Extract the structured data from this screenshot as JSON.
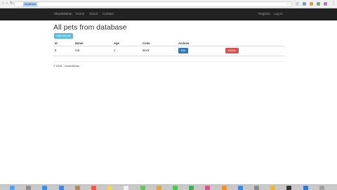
{
  "browser": {
    "url": "localhost"
  },
  "navbar": {
    "brand": "VroomDemo",
    "links": [
      "Home",
      "About",
      "Contact"
    ],
    "register": "Register",
    "login": "Log in"
  },
  "page": {
    "title": "All pets from database",
    "create_label": "Add new pet",
    "columns": [
      "Id",
      "Name",
      "Age",
      "Color",
      "Actions"
    ],
    "rows": [
      {
        "id": "8",
        "name": "Cat",
        "age": "1",
        "color": "black",
        "edit": "Edit",
        "delete": "Delete"
      }
    ],
    "footer": "© 2016 - VroomDemo"
  },
  "colors": {
    "navbar": "#222222",
    "create_button": "#5bc0de",
    "edit_button": "#337ab7",
    "delete_button": "#d9534f"
  },
  "dock": {
    "icons": [
      "finder-icon",
      "launchpad-icon",
      "safari-icon",
      "mail-icon",
      "contacts-icon",
      "calendar-icon",
      "notes-icon",
      "reminders-icon",
      "maps-icon",
      "photos-icon",
      "messages-icon",
      "facetime-icon",
      "itunes-icon",
      "ibooks-icon",
      "app-store-icon",
      "system-preferences-icon",
      "chrome-icon",
      "terminal-icon",
      "visual-studio-code-icon",
      "trash-icon"
    ]
  }
}
